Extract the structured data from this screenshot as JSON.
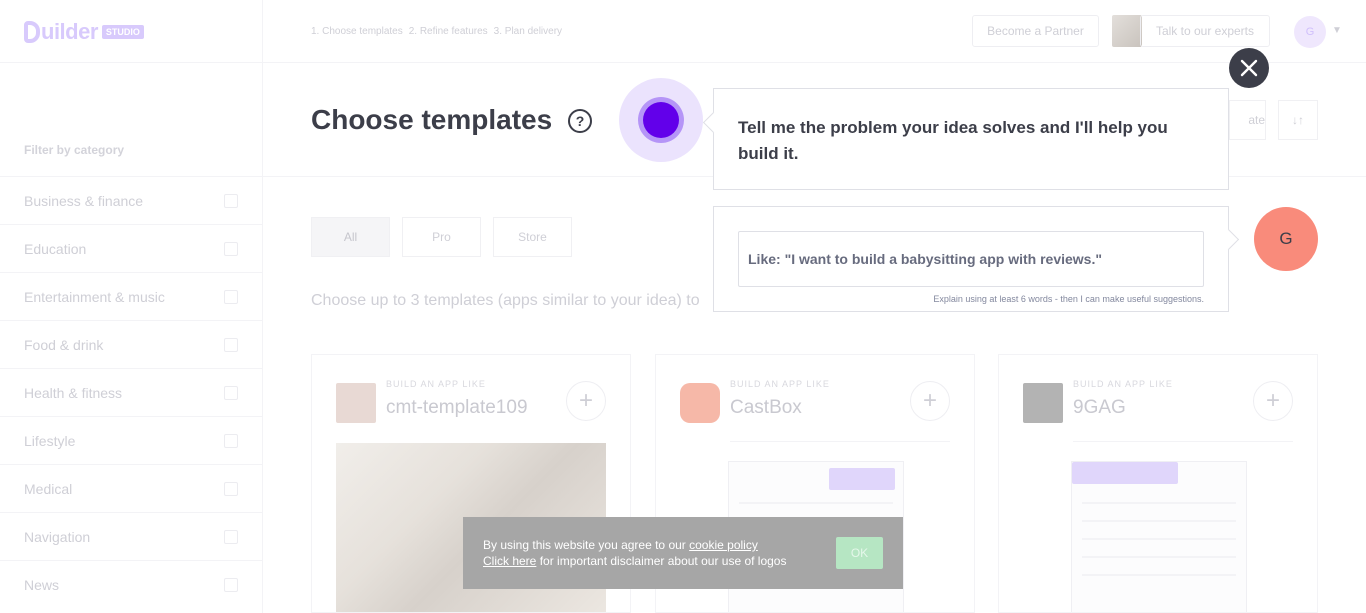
{
  "brand": {
    "logo_text": "uilder",
    "logo_badge": "STUDIO"
  },
  "header": {
    "steps": [
      "1. Choose templates",
      "2. Refine features",
      "3. Plan delivery"
    ],
    "partner_label": "Become a Partner",
    "experts_label": "Talk to our experts",
    "user_initial": "G"
  },
  "sidebar": {
    "filter_title": "Filter by category",
    "categories": [
      {
        "label": "Business & finance"
      },
      {
        "label": "Education"
      },
      {
        "label": "Entertainment & music"
      },
      {
        "label": "Food & drink"
      },
      {
        "label": "Health & fitness"
      },
      {
        "label": "Lifestyle"
      },
      {
        "label": "Medical"
      },
      {
        "label": "Navigation"
      },
      {
        "label": "News"
      }
    ]
  },
  "main": {
    "title": "Choose templates",
    "help_icon": "?",
    "tabs": [
      {
        "label": "All"
      },
      {
        "label": "Pro"
      },
      {
        "label": "Store"
      }
    ],
    "subtitle": "Choose up to 3 templates (apps similar to your idea) to",
    "create_label": "ate",
    "sort_icon": "↓↑",
    "cards": [
      {
        "kicker": "BUILD AN APP LIKE",
        "name": "cmt-template109",
        "icon_color": "#e8d9d4"
      },
      {
        "kicker": "BUILD AN APP LIKE",
        "name": "CastBox",
        "icon_color": "#f6b8a8"
      },
      {
        "kicker": "BUILD AN APP LIKE",
        "name": "9GAG",
        "icon_color": "#b3b3b3"
      }
    ]
  },
  "assistant": {
    "message": "Tell me the problem your idea solves and I'll help you build it.",
    "input_placeholder": "Like: \"I want to build a babysitting app with reviews.\"",
    "input_value": "",
    "hint": "Explain using at least 6 words - then I can make useful suggestions.",
    "user_initial": "G",
    "close_icon": "close-icon"
  },
  "cookie": {
    "prefix": "By using this website you agree to our ",
    "policy_link": "cookie policy",
    "click_here": "Click here",
    "suffix": " for important disclaimer about our use of logos",
    "ok_label": "OK"
  },
  "colors": {
    "accent": "#6200ea",
    "dark": "#3c3e49",
    "user_avatar": "#f98b7b",
    "cookie_ok": "#b6e6c3"
  }
}
